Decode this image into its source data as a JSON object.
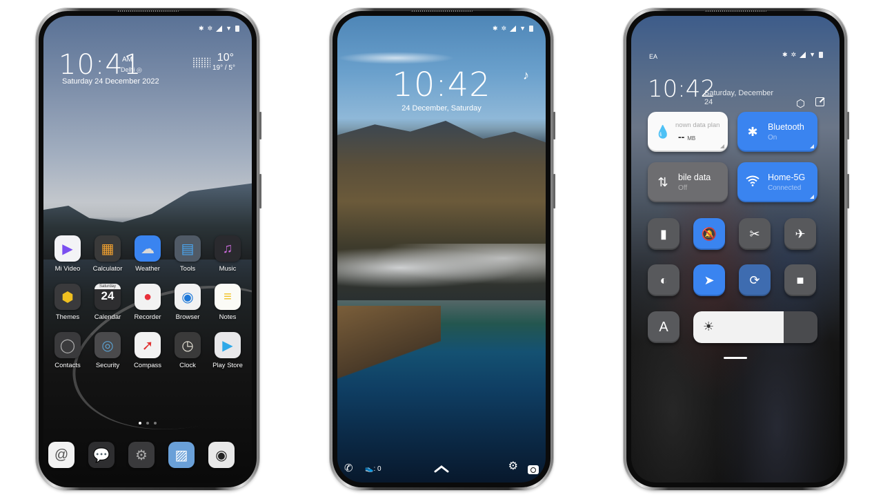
{
  "status_bar": {
    "icons": [
      "bluetooth-icon",
      "mute-icon",
      "signal-icon",
      "wifi-icon",
      "battery-icon"
    ]
  },
  "home": {
    "clock": {
      "time": "10:41",
      "ampm": "AM",
      "city": "Delhi",
      "date": "Saturday 24  December 2022"
    },
    "weather": {
      "temp": "10°",
      "range": "19° / 5°",
      "icon": "fog-icon"
    },
    "rows": [
      [
        {
          "label": "Mi Video",
          "icon": "mi-video-icon",
          "glyph": "▶",
          "bg": "#f3f3f6",
          "fg": "#7a4ef0"
        },
        {
          "label": "Calculator",
          "icon": "calculator-icon",
          "glyph": "▦",
          "bg": "#3a3a3a",
          "fg": "#f0a030"
        },
        {
          "label": "Weather",
          "icon": "weather-icon",
          "glyph": "☁",
          "bg": "#3a84f0",
          "fg": "#d8d8d8"
        },
        {
          "label": "Tools",
          "icon": "tools-folder-icon",
          "glyph": "▤",
          "bg": "#505a66",
          "fg": "#4aa6f0"
        },
        {
          "label": "Music",
          "icon": "music-icon",
          "glyph": "♫",
          "bg": "#2a2a2e",
          "fg": "#c86ad8"
        }
      ],
      [
        {
          "label": "Themes",
          "icon": "themes-icon",
          "glyph": "⬢",
          "bg": "#3a3a3c",
          "fg": "#f0c020"
        },
        {
          "label": "Calendar",
          "icon": "calendar-icon",
          "glyph": "24",
          "bg": "#2e2e30",
          "fg": "#ffffff"
        },
        {
          "label": "Recorder",
          "icon": "recorder-icon",
          "glyph": "●",
          "bg": "#f2f2f2",
          "fg": "#e8303a"
        },
        {
          "label": "Browser",
          "icon": "browser-icon",
          "glyph": "◉",
          "bg": "#f2f2f2",
          "fg": "#1e78d8"
        },
        {
          "label": "Notes",
          "icon": "notes-icon",
          "glyph": "≡",
          "bg": "#fbfbf6",
          "fg": "#f0c020"
        }
      ],
      [
        {
          "label": "Contacts",
          "icon": "contacts-icon",
          "glyph": "◯",
          "bg": "#3a3a3c",
          "fg": "#aaaaaa"
        },
        {
          "label": "Security",
          "icon": "security-icon",
          "glyph": "◎",
          "bg": "#4a4a4c",
          "fg": "#5aa0d0"
        },
        {
          "label": "Compass",
          "icon": "compass-icon",
          "glyph": "➚",
          "bg": "#f2f2f2",
          "fg": "#e03030"
        },
        {
          "label": "Clock",
          "icon": "clock-icon",
          "glyph": "◷",
          "bg": "#3a3a3a",
          "fg": "#e8e4d8"
        },
        {
          "label": "Play Store",
          "icon": "play-store-icon",
          "glyph": "▶",
          "bg": "#e8e8ea",
          "fg": "#2ea8e8"
        }
      ]
    ],
    "calendar_day": "Saturday",
    "page_dots": {
      "count": 3,
      "active": 0
    },
    "dock": [
      {
        "icon": "contacts-card-icon",
        "glyph": "@",
        "bg": "#f2f2f2",
        "fg": "#555555"
      },
      {
        "icon": "messages-icon",
        "glyph": "💬",
        "bg": "#2e2e30",
        "fg": "#dddddd"
      },
      {
        "icon": "settings-icon",
        "glyph": "⚙",
        "bg": "#3a3a3c",
        "fg": "#aaaaaa"
      },
      {
        "icon": "gallery-icon",
        "glyph": "▨",
        "bg": "#6aa0d8",
        "fg": "#ffffff"
      },
      {
        "icon": "camera-icon",
        "glyph": "◉",
        "bg": "#e8e8e8",
        "fg": "#222222"
      }
    ]
  },
  "lock": {
    "time": "10:42",
    "date": "24 December, Saturday",
    "steps": ": 0",
    "shortcuts": [
      "phone-icon",
      "steps-icon",
      "swipe-up-chevron-icon",
      "settings-icon",
      "camera-icon"
    ]
  },
  "control_center": {
    "carrier": "EA",
    "time": "10:42",
    "date": "Saturday, December 24",
    "tiles": {
      "data": {
        "title": "nown data plan",
        "value": "--",
        "unit": "MB"
      },
      "bluetooth": {
        "title": "Bluetooth",
        "sub": "On"
      },
      "mobile": {
        "title": "bile data",
        "sub": "Off"
      },
      "wifi": {
        "title": "Home-5G",
        "sub": "Connected"
      }
    },
    "toggles": [
      {
        "name": "flashlight",
        "glyph": "▮",
        "on": false
      },
      {
        "name": "silent",
        "glyph": "🔕",
        "on": true
      },
      {
        "name": "screenshot",
        "glyph": "✂",
        "on": false
      },
      {
        "name": "airplane-mode",
        "glyph": "✈",
        "on": false
      },
      {
        "name": "dark-mode",
        "glyph": "◐",
        "on": false
      },
      {
        "name": "location",
        "glyph": "➤",
        "on": true
      },
      {
        "name": "rotation-lock",
        "glyph": "⟳",
        "on": true
      },
      {
        "name": "screen-recorder",
        "glyph": "■",
        "on": false
      }
    ],
    "auto_brightness_label": "A",
    "brightness_percent": 73,
    "colors": {
      "accent": "#3a84f0",
      "tile_off": "#58595c"
    }
  }
}
